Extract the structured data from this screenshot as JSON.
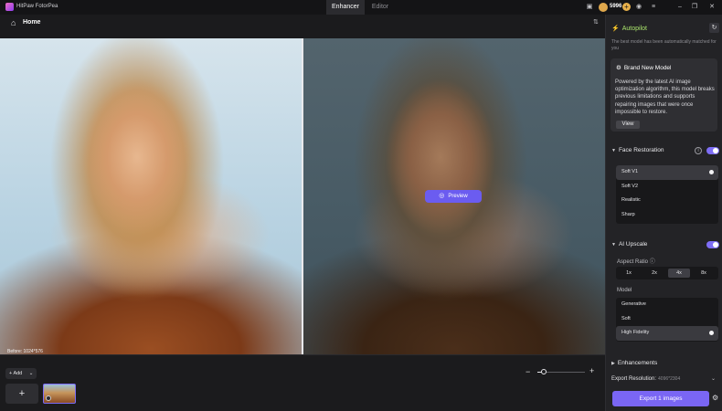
{
  "app": {
    "name": "HitPaw FotorPea"
  },
  "tabs": [
    {
      "label": "Enhancer",
      "active": true
    },
    {
      "label": "Editor",
      "active": false
    }
  ],
  "titlebar": {
    "coins": "5996"
  },
  "nav": {
    "home_label": "Home"
  },
  "canvas": {
    "before_label": "Before: 1024*576",
    "preview_label": "Preview"
  },
  "bottom": {
    "add_label": "Add"
  },
  "panel": {
    "autopilot_label": "Autopilot",
    "autopilot_note": "The best model has been automatically matched for you",
    "model_card": {
      "title": "Brand New Model",
      "description": "Powered by the latest AI image optimization algorithm, this model breaks previous limitations and supports repairing images that were once impossible to restore.",
      "view_label": "View"
    },
    "face_restoration": {
      "label": "Face Restoration",
      "enabled": true,
      "options": [
        "Soft V1",
        "Soft V2",
        "Realistic",
        "Sharp"
      ],
      "selected": "Soft V1"
    },
    "ai_upscale": {
      "label": "AI Upscale",
      "enabled": true,
      "aspect_ratio_label": "Aspect Ratio",
      "ratios": [
        "1x",
        "2x",
        "4x",
        "8x"
      ],
      "selected_ratio": "4x",
      "model_label": "Model",
      "models": [
        "Generative",
        "Soft",
        "High Fidelity"
      ],
      "selected_model": "High Fidelity"
    },
    "enhancements_label": "Enhancements",
    "export_resolution_label": "Export Resolution:",
    "export_resolution_value": "4096*2304",
    "export_button_label": "Export 1 images"
  },
  "colors": {
    "accent": "#7a66f4",
    "autopilot": "#a9e36b",
    "coin": "#e0a84c"
  }
}
